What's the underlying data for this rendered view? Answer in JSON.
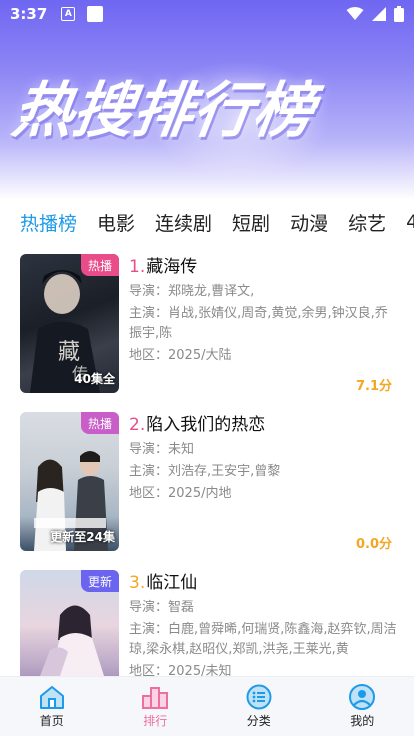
{
  "status_bar": {
    "time": "3:37",
    "notif_letter": "A"
  },
  "hero": {
    "title": "热搜排行榜"
  },
  "tabs": [
    {
      "label": "热播榜",
      "active": true
    },
    {
      "label": "电影"
    },
    {
      "label": "连续剧"
    },
    {
      "label": "短剧"
    },
    {
      "label": "动漫"
    },
    {
      "label": "综艺"
    },
    {
      "label": "4"
    }
  ],
  "items": [
    {
      "rank": "1.",
      "rank_color": "#e84d8a",
      "title": "藏海传",
      "badge": "热播",
      "badge_color": "#e84d8a",
      "poster_caption": "40集全",
      "director": "导演：郑晓龙,曹译文,",
      "actors": "主演：肖战,张婧仪,周奇,黄觉,余男,钟汉良,乔振宇,陈",
      "region": "地区：2025/大陆",
      "score": "7.1分"
    },
    {
      "rank": "2.",
      "rank_color": "#e84d8a",
      "title": "陷入我们的热恋",
      "badge": "热播",
      "badge_color": "#c95ec8",
      "poster_caption": "更新至24集",
      "director": "导演：未知",
      "actors": "主演：刘浩存,王安宇,曾黎",
      "region": "地区：2025/内地",
      "score": "0.0分"
    },
    {
      "rank": "3.",
      "rank_color": "#f5a623",
      "title": "临江仙",
      "badge": "更新",
      "badge_color": "#6b64ef",
      "poster_caption": "",
      "director": "导演：智磊",
      "actors": "主演：白鹿,曾舜晞,何瑞贤,陈鑫海,赵弈钦,周洁琼,梁永棋,赵昭仪,郑凯,洪尧,王莱光,黄",
      "region": "地区：2025/未知",
      "score": ""
    }
  ],
  "nav": [
    {
      "label": "首页",
      "icon": "home-icon"
    },
    {
      "label": "排行",
      "icon": "ranking-icon",
      "active": true
    },
    {
      "label": "分类",
      "icon": "category-icon"
    },
    {
      "label": "我的",
      "icon": "profile-icon"
    }
  ],
  "colors": {
    "accent_blue": "#1e9be8",
    "score_orange": "#f5a623",
    "nav_active_pink": "#ef6ea0"
  }
}
